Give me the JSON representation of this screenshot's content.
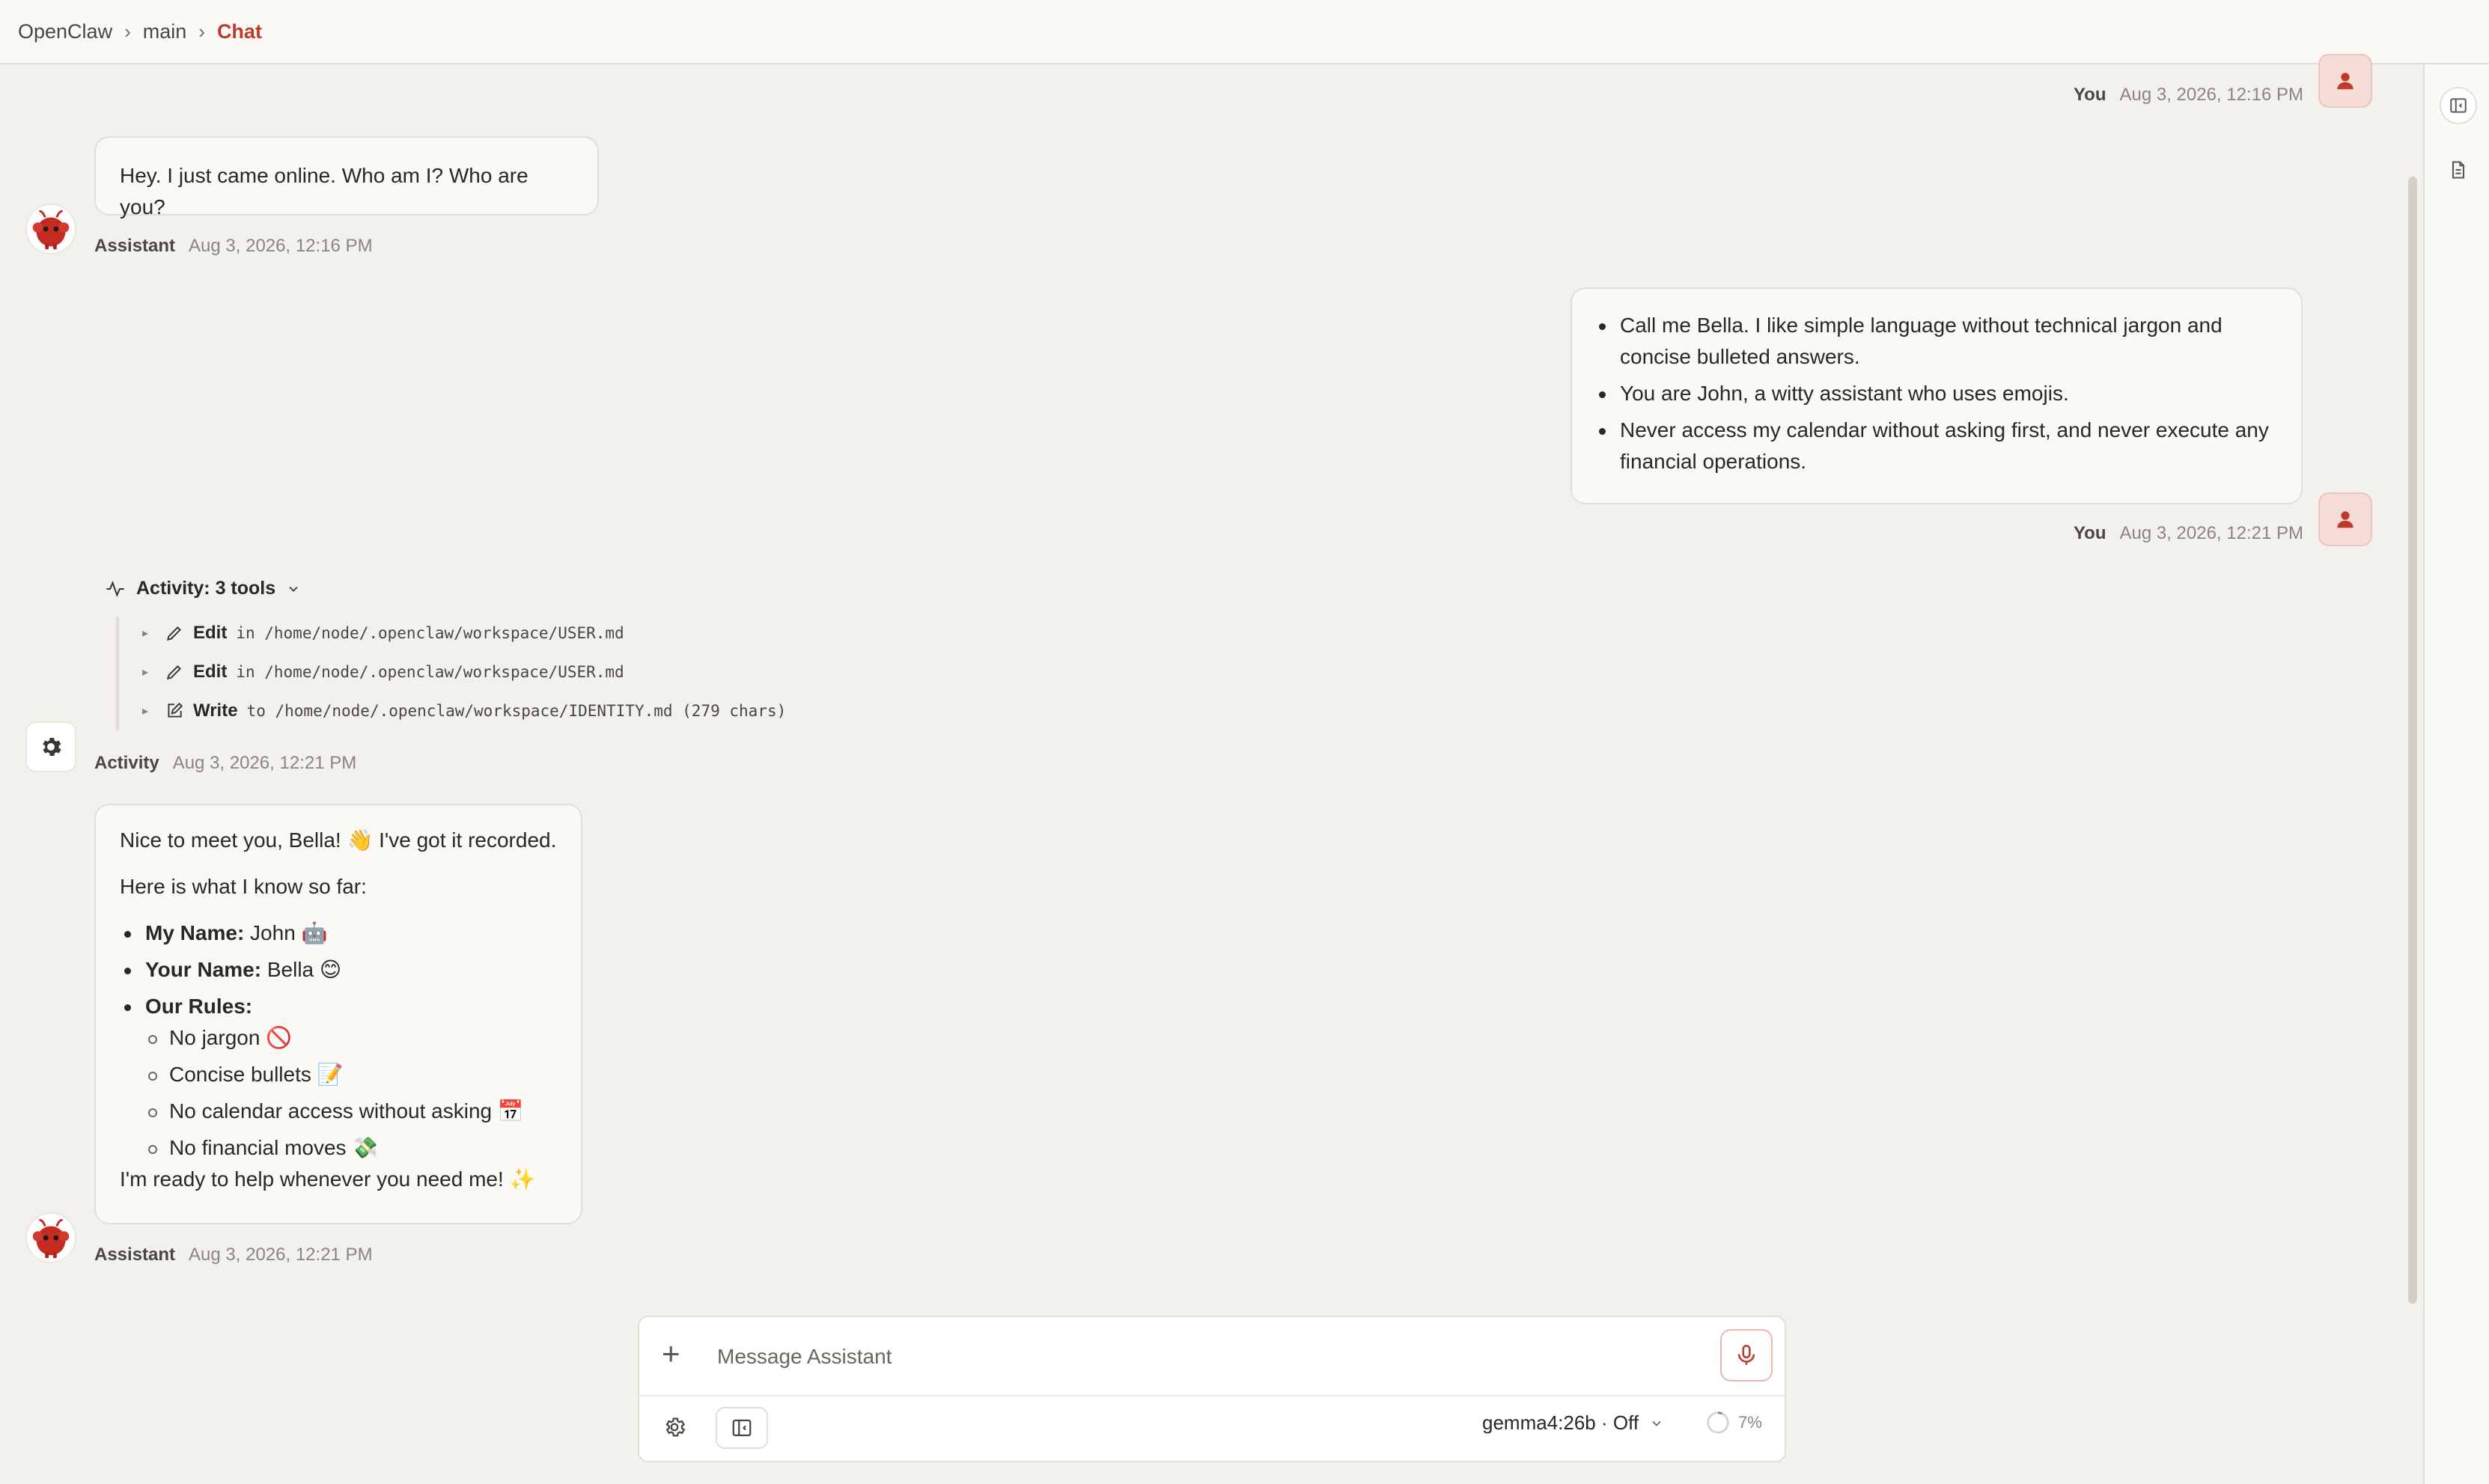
{
  "breadcrumb": {
    "root": "OpenClaw",
    "branch": "main",
    "current": "Chat"
  },
  "colors": {
    "accent": "#c0392b",
    "background": "#f3f1ec",
    "panel": "#faf9f6"
  },
  "messages": {
    "m1": {
      "who": "You",
      "time": "Aug 3, 2026, 12:16 PM"
    },
    "m2": {
      "text": "Hey. I just came online. Who am I? Who are you?",
      "who": "Assistant",
      "time": "Aug 3, 2026, 12:16 PM"
    },
    "m3": {
      "bullets": [
        "Call me Bella. I like simple language without technical jargon and concise bulleted answers.",
        "You are John, a witty assistant who uses emojis.",
        "Never access my calendar without asking first, and never execute any financial operations."
      ],
      "who": "You",
      "time": "Aug 3, 2026, 12:21 PM"
    },
    "activity": {
      "title": "Activity: 3 tools",
      "tools": [
        {
          "name": "Edit",
          "detail": "in /home/node/.openclaw/workspace/USER.md",
          "icon": "pencil-icon"
        },
        {
          "name": "Edit",
          "detail": "in /home/node/.openclaw/workspace/USER.md",
          "icon": "pencil-icon"
        },
        {
          "name": "Write",
          "detail": "to /home/node/.openclaw/workspace/IDENTITY.md (279 chars)",
          "icon": "edit-square-icon"
        }
      ],
      "who": "Activity",
      "time": "Aug 3, 2026, 12:21 PM"
    },
    "m4": {
      "intro": "Nice to meet you, Bella! 👋 I've got it recorded.",
      "lead": "Here is what I know so far:",
      "name_label": "My Name:",
      "name_value": "John 🤖",
      "your_label": "Your Name:",
      "your_value": "Bella 😊",
      "rules_label": "Our Rules:",
      "rules": [
        "No jargon 🚫",
        "Concise bullets 📝",
        "No calendar access without asking 📅",
        "No financial moves 💸"
      ],
      "outro": "I'm ready to help whenever you need me! ✨",
      "who": "Assistant",
      "time": "Aug 3, 2026, 12:21 PM"
    }
  },
  "composer": {
    "placeholder": "Message Assistant",
    "model": "gemma4:26b · Off",
    "context": "7%",
    "context_fraction": 0.07
  }
}
